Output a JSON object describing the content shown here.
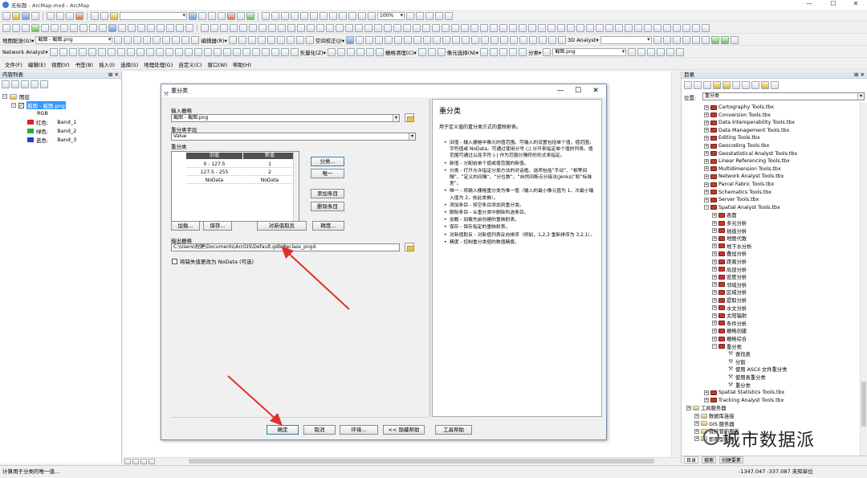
{
  "window": {
    "title": "无标题 - ArcMap.mxd - ArcMap",
    "minimize": "—",
    "maximize": "☐",
    "close": "✕"
  },
  "toolbars": {
    "row2": {
      "scale_value": "",
      "zoom_pct": "100%"
    },
    "row3": {
      "layout_combo": "地图配准(G)▾",
      "layer_combo": "截图 - 截图.png",
      "editor_label": "编辑器(R)▾",
      "spatial_adjust_label": "空间校正(J)▾",
      "capture_label": "捕捉(S)▾",
      "analyst_label": "3D Analyst▾"
    },
    "row4": {
      "network_analyst": "Network Analyst▾",
      "vectorize_label": "矢量化(Z)▾",
      "raster_clean_label": "栅格清理(C)▾",
      "cell_select_label": "像元选择(N)▾",
      "classify_label": "分类▾",
      "raster_layer_combo": "截图.png"
    }
  },
  "menubar": [
    "文件(F)",
    "编辑(E)",
    "视图(V)",
    "书签(B)",
    "插入(I)",
    "选择(S)",
    "地理处理(G)",
    "自定义(C)",
    "窗口(W)",
    "帮助(H)"
  ],
  "toc": {
    "title": "内容列表",
    "pin": "⊞ ✕",
    "root_layer": "图层",
    "raster_layer": "截图 - 截图.png",
    "rgb_label": "RGB",
    "bands": [
      {
        "label": "红色:",
        "band": "Band_1",
        "color": "#e02020"
      },
      {
        "label": "绿色:",
        "band": "Band_2",
        "color": "#20b040"
      },
      {
        "label": "蓝色:",
        "band": "Band_3",
        "color": "#2040d0"
      }
    ]
  },
  "catalog": {
    "title": "目录",
    "pin": "⊞ ✕",
    "location_label": "位置:",
    "location_value": "重分类",
    "toolboxes": [
      "Cartography Tools.tbx",
      "Conversion Tools.tbx",
      "Data Interoperability Tools.tbx",
      "Data Management Tools.tbx",
      "Editing Tools.tbx",
      "Geocoding Tools.tbx",
      "Geostatistical Analyst Tools.tbx",
      "Linear Referencing Tools.tbx",
      "Multidimension Tools.tbx",
      "Network Analyst Tools.tbx",
      "Parcel Fabric Tools.tbx",
      "Schematics Tools.tbx",
      "Server Tools.tbx",
      "Spatial Analyst Tools.tbx"
    ],
    "spatial_analyst_sets": [
      "表面",
      "多元分析",
      "插值分析",
      "地图代数",
      "地下水分析",
      "叠加分析",
      "距离分析",
      "局部分析",
      "密度分析",
      "邻域分析",
      "区域分析",
      "提取分析",
      "水文分析",
      "太阳辐射",
      "条件分析",
      "栅格创建",
      "栅格综合",
      "重分类"
    ],
    "reclass_tools": [
      "查找表",
      "分割",
      "使用 ASCII 文件重分类",
      "使用表重分类",
      "重分类"
    ],
    "after_toolboxes": [
      "Spatial Statistics Tools.tbx",
      "Tracking Analyst Tools.tbx"
    ],
    "bottom_items": [
      "工具服务器",
      "数据库连接",
      "GIS 服务器",
      "我托管的服务",
      "即用型服务"
    ],
    "tabs": [
      "目录",
      "搜索",
      "创建要素"
    ]
  },
  "dialog": {
    "title": "重分类",
    "input_raster_label": "输入栅格",
    "input_raster_value": "截图 - 截图.png",
    "reclass_field_label": "重分类字段",
    "reclass_field_value": "Value",
    "reclass_label": "重分类",
    "table_headers": [
      "旧值",
      "新值"
    ],
    "table_rows": [
      [
        "0 - 127.5",
        "1"
      ],
      [
        "127.5 - 255",
        "2"
      ],
      [
        "NoData",
        "NoData"
      ]
    ],
    "buttons_right": [
      "分类...",
      "唯一",
      "添加条目",
      "删除条目"
    ],
    "buttons_bottom": [
      "加载...",
      "保存...",
      "对新值取反",
      "精度..."
    ],
    "output_raster_label": "输出栅格",
    "output_raster_value": "C:\\Users\\程建\\Documents\\ArcGIS\\Default.gdb\\Reclass_png4",
    "nodata_checkbox": "将缺失值更改为 NoData (可选)",
    "footer_buttons": [
      "确定",
      "取消",
      "环境...",
      "<< 隐藏帮助",
      "工具帮助"
    ],
    "help": {
      "title": "重分类",
      "intro": "用于定义值的重分类方式的重映射表。",
      "items": [
        "旧值 - 输入栅格中像元的值范围。可输入的设置包括单个值，值范围，字符值或 NoData。可通过使用分号 (;) 分开来指定单个值的列表。值范围可通过以连字符 (-) 作为范围分隔符的形式来指定。",
        "新值 - 分配给单个值或值范围的新值。",
        "分类 - 打开允许指定分类方法的对话框。选项包括“手动”、“相等间隔”、“定义的间隔”、“分位数”、“自然间断点分级法(Jenks)”和“标准差”。",
        "唯一 - 将输入栅格重分类为唯一值（输入的最小像元值为 1，次最小输入值为 2，依此类推）。",
        "添加条目 - 将空条目添加到重分类。",
        "删除条目 - 从重分类中删除所选条目。",
        "加载 - 加载先前创建的重映射表。",
        "保存 - 保存指定的重映射表。",
        "对新值取反 - 对新值列表反向排序（例如，1,2,3 重新排序为 3,2,1）。",
        "精度 - 控制重分类值的数值精度。"
      ]
    }
  },
  "status": {
    "message": "计算用于分类的唯一值...",
    "coords": "-1347.047   -337.087 未知单位"
  },
  "watermark": "城市数据派"
}
